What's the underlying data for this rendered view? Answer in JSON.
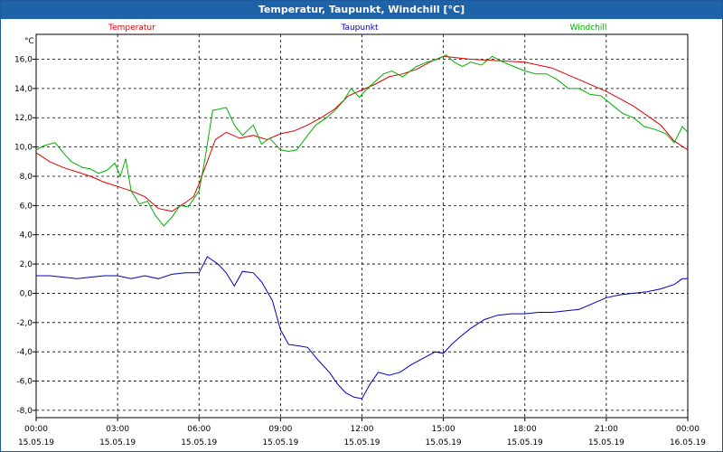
{
  "window": {
    "title": "Temperatur, Taupunkt, Windchill [°C]"
  },
  "chart_data": {
    "type": "line",
    "ylabel": "°C",
    "ylim": [
      -8.5,
      17.7
    ],
    "y_ticks": [
      16,
      14,
      12,
      10,
      8,
      6,
      4,
      2,
      0,
      -2,
      -4,
      -6,
      -8
    ],
    "y_tick_labels": [
      "16,0",
      "14,0",
      "12,0",
      "10,0",
      "8,0",
      "6,0",
      "4,0",
      "2,0",
      "0,0",
      "-2,0",
      "-4,0",
      "-6,0",
      "-8,0"
    ],
    "x_range_hours": [
      0,
      24
    ],
    "x_ticks": [
      0,
      3,
      6,
      9,
      12,
      15,
      18,
      21,
      24
    ],
    "x_tick_labels": [
      {
        "time": "00:00",
        "date": "15.05.19"
      },
      {
        "time": "03:00",
        "date": "15.05.19"
      },
      {
        "time": "06:00",
        "date": "15.05.19"
      },
      {
        "time": "09:00",
        "date": "15.05.19"
      },
      {
        "time": "12:00",
        "date": "15.05.19"
      },
      {
        "time": "15:00",
        "date": "15.05.19"
      },
      {
        "time": "18:00",
        "date": "15.05.19"
      },
      {
        "time": "21:00",
        "date": "15.05.19"
      },
      {
        "time": "00:00",
        "date": "16.05.19"
      }
    ],
    "grid": true,
    "series": [
      {
        "name": "Temperatur",
        "color": "#e00000",
        "points": [
          [
            0,
            9.6
          ],
          [
            0.5,
            9.0
          ],
          [
            1,
            8.6
          ],
          [
            1.5,
            8.3
          ],
          [
            2,
            8.0
          ],
          [
            2.5,
            7.6
          ],
          [
            3,
            7.3
          ],
          [
            3.5,
            7.0
          ],
          [
            4,
            6.6
          ],
          [
            4.5,
            5.8
          ],
          [
            5,
            5.6
          ],
          [
            5.5,
            6.2
          ],
          [
            5.8,
            6.6
          ],
          [
            6,
            7.5
          ],
          [
            6.3,
            9.0
          ],
          [
            6.6,
            10.5
          ],
          [
            7,
            11.0
          ],
          [
            7.5,
            10.6
          ],
          [
            8,
            10.8
          ],
          [
            8.5,
            10.5
          ],
          [
            9,
            10.9
          ],
          [
            9.5,
            11.1
          ],
          [
            10,
            11.5
          ],
          [
            10.5,
            12.0
          ],
          [
            11,
            12.6
          ],
          [
            11.5,
            13.5
          ],
          [
            12,
            13.9
          ],
          [
            12.5,
            14.3
          ],
          [
            13,
            14.8
          ],
          [
            13.5,
            15.0
          ],
          [
            14,
            15.3
          ],
          [
            14.5,
            15.8
          ],
          [
            15,
            16.2
          ],
          [
            15.5,
            16.1
          ],
          [
            16,
            16.0
          ],
          [
            17,
            15.9
          ],
          [
            18,
            15.8
          ],
          [
            19,
            15.4
          ],
          [
            19.5,
            15.0
          ],
          [
            20,
            14.6
          ],
          [
            21,
            13.8
          ],
          [
            22,
            12.8
          ],
          [
            23,
            11.5
          ],
          [
            23.5,
            10.4
          ],
          [
            24,
            9.8
          ]
        ]
      },
      {
        "name": "Taupunkt",
        "color": "#0000c0",
        "points": [
          [
            0,
            1.2
          ],
          [
            0.5,
            1.2
          ],
          [
            1,
            1.1
          ],
          [
            1.5,
            1.0
          ],
          [
            2,
            1.1
          ],
          [
            2.5,
            1.2
          ],
          [
            3,
            1.2
          ],
          [
            3.5,
            1.0
          ],
          [
            4,
            1.2
          ],
          [
            4.5,
            1.0
          ],
          [
            5,
            1.3
          ],
          [
            5.5,
            1.4
          ],
          [
            6,
            1.4
          ],
          [
            6.3,
            2.5
          ],
          [
            6.7,
            2.0
          ],
          [
            7,
            1.4
          ],
          [
            7.3,
            0.5
          ],
          [
            7.6,
            1.5
          ],
          [
            8,
            1.4
          ],
          [
            8.3,
            0.8
          ],
          [
            8.7,
            -0.5
          ],
          [
            9,
            -2.5
          ],
          [
            9.3,
            -3.5
          ],
          [
            9.7,
            -3.6
          ],
          [
            10,
            -3.7
          ],
          [
            10.4,
            -4.6
          ],
          [
            10.8,
            -5.4
          ],
          [
            11.1,
            -6.2
          ],
          [
            11.4,
            -6.8
          ],
          [
            11.7,
            -7.1
          ],
          [
            12,
            -7.2
          ],
          [
            12.3,
            -6.2
          ],
          [
            12.6,
            -5.4
          ],
          [
            13,
            -5.6
          ],
          [
            13.4,
            -5.4
          ],
          [
            13.8,
            -4.9
          ],
          [
            14.3,
            -4.4
          ],
          [
            14.7,
            -4.0
          ],
          [
            15,
            -4.1
          ],
          [
            15.3,
            -3.5
          ],
          [
            15.6,
            -3.0
          ],
          [
            16,
            -2.4
          ],
          [
            16.5,
            -1.8
          ],
          [
            17,
            -1.5
          ],
          [
            17.5,
            -1.4
          ],
          [
            18,
            -1.4
          ],
          [
            18.5,
            -1.3
          ],
          [
            19,
            -1.3
          ],
          [
            19.5,
            -1.2
          ],
          [
            20,
            -1.1
          ],
          [
            20.5,
            -0.7
          ],
          [
            21,
            -0.3
          ],
          [
            21.5,
            -0.1
          ],
          [
            22,
            0.0
          ],
          [
            22.5,
            0.1
          ],
          [
            23,
            0.3
          ],
          [
            23.5,
            0.6
          ],
          [
            23.8,
            1.0
          ],
          [
            24,
            1.0
          ]
        ]
      },
      {
        "name": "Windchill",
        "color": "#00b000",
        "points": [
          [
            0,
            9.8
          ],
          [
            0.3,
            10.1
          ],
          [
            0.7,
            10.3
          ],
          [
            1,
            9.6
          ],
          [
            1.3,
            9.0
          ],
          [
            1.7,
            8.6
          ],
          [
            2,
            8.5
          ],
          [
            2.3,
            8.2
          ],
          [
            2.6,
            8.4
          ],
          [
            2.9,
            8.9
          ],
          [
            3.1,
            8.0
          ],
          [
            3.3,
            9.2
          ],
          [
            3.5,
            7.0
          ],
          [
            3.8,
            6.1
          ],
          [
            4.1,
            6.3
          ],
          [
            4.4,
            5.3
          ],
          [
            4.7,
            4.6
          ],
          [
            5,
            5.2
          ],
          [
            5.3,
            6.0
          ],
          [
            5.6,
            5.9
          ],
          [
            6,
            7.0
          ],
          [
            6.2,
            9.0
          ],
          [
            6.5,
            12.5
          ],
          [
            7,
            12.7
          ],
          [
            7.3,
            11.5
          ],
          [
            7.6,
            10.8
          ],
          [
            8,
            11.5
          ],
          [
            8.3,
            10.2
          ],
          [
            8.6,
            10.6
          ],
          [
            9,
            9.8
          ],
          [
            9.3,
            9.7
          ],
          [
            9.6,
            9.8
          ],
          [
            10,
            10.8
          ],
          [
            10.3,
            11.5
          ],
          [
            10.7,
            12.0
          ],
          [
            11,
            12.5
          ],
          [
            11.3,
            13.1
          ],
          [
            11.6,
            14.0
          ],
          [
            11.9,
            13.4
          ],
          [
            12.2,
            14.0
          ],
          [
            12.5,
            14.5
          ],
          [
            12.8,
            15.0
          ],
          [
            13.1,
            15.2
          ],
          [
            13.5,
            14.8
          ],
          [
            14,
            15.5
          ],
          [
            14.4,
            15.8
          ],
          [
            14.8,
            16.0
          ],
          [
            15.1,
            16.3
          ],
          [
            15.4,
            15.8
          ],
          [
            15.7,
            15.5
          ],
          [
            16,
            15.8
          ],
          [
            16.4,
            15.6
          ],
          [
            16.8,
            16.2
          ],
          [
            17.2,
            15.8
          ],
          [
            17.6,
            15.5
          ],
          [
            18,
            15.2
          ],
          [
            18.4,
            15.0
          ],
          [
            18.8,
            15.0
          ],
          [
            19.2,
            14.6
          ],
          [
            19.6,
            14.0
          ],
          [
            20,
            14.0
          ],
          [
            20.4,
            13.6
          ],
          [
            20.8,
            13.5
          ],
          [
            21.2,
            12.9
          ],
          [
            21.6,
            12.3
          ],
          [
            22,
            12.0
          ],
          [
            22.4,
            11.4
          ],
          [
            22.8,
            11.2
          ],
          [
            23.2,
            10.9
          ],
          [
            23.5,
            10.3
          ],
          [
            23.8,
            11.4
          ],
          [
            24,
            11.0
          ]
        ]
      }
    ]
  }
}
